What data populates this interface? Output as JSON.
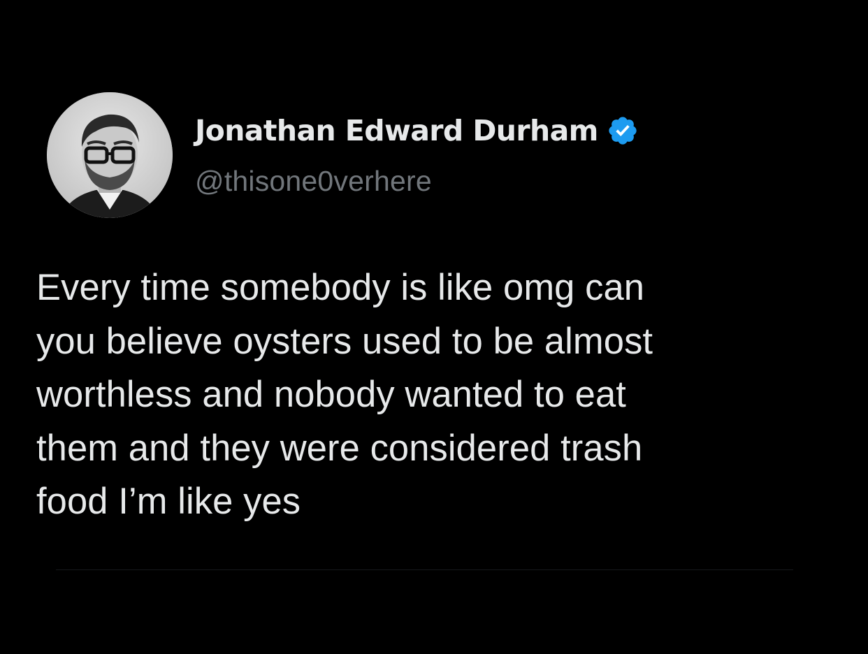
{
  "tweet": {
    "author": {
      "display_name": "Jonathan Edward Durham",
      "handle": "@thisone0verhere",
      "avatar": "profile-photo-avatar",
      "verified_icon": "verified-badge-icon",
      "verified_color": "#1d9bf0"
    },
    "text": "Every time somebody is like omg can\nyou believe oysters used to be almost\nworthless and nobody wanted to eat\nthem and they were considered trash\nfood I’m like yes"
  },
  "colors": {
    "background": "#000000",
    "primary_text": "#e7e9ea",
    "secondary_text": "#71767b",
    "divider": "#16181c"
  }
}
